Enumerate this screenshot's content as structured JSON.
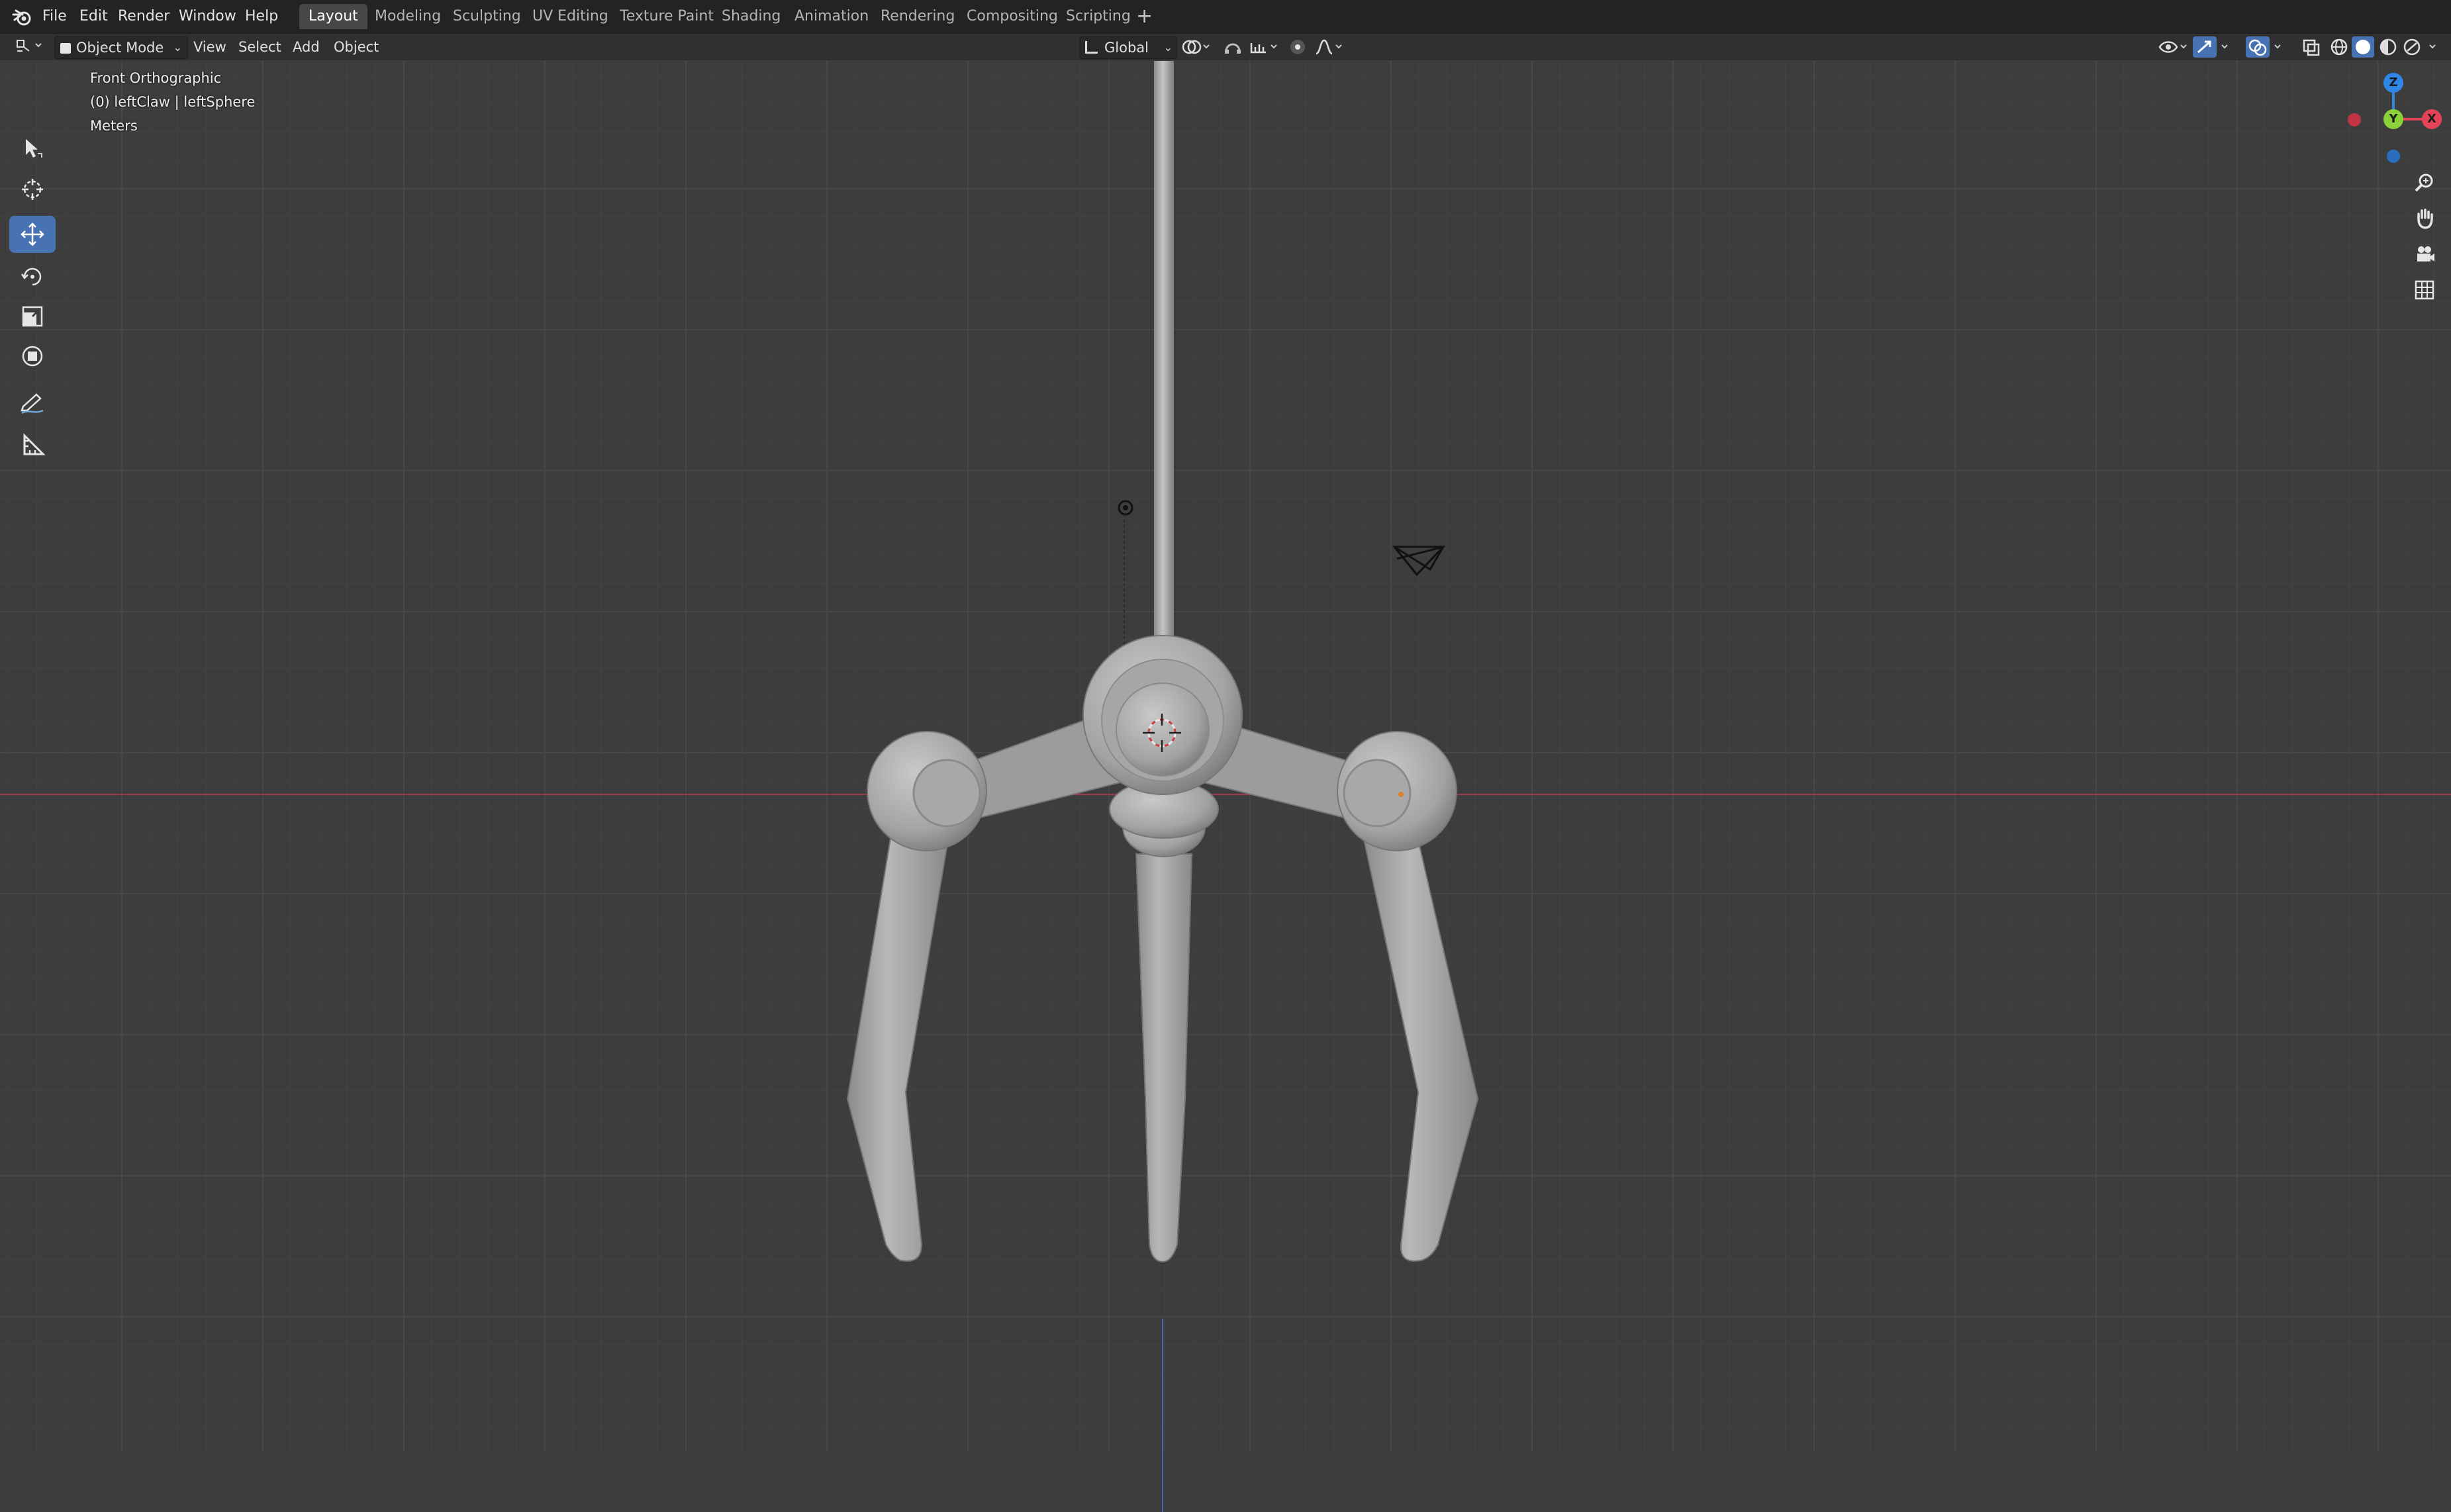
{
  "app": {
    "menus": [
      "File",
      "Edit",
      "Render",
      "Window",
      "Help"
    ],
    "workspace_tabs": [
      "Layout",
      "Modeling",
      "Sculpting",
      "UV Editing",
      "Texture Paint",
      "Shading",
      "Animation",
      "Rendering",
      "Compositing",
      "Scripting"
    ],
    "active_tab": "Layout",
    "add_tab_label": "+"
  },
  "header": {
    "mode": "Object Mode",
    "menus": [
      "View",
      "Select",
      "Add",
      "Object"
    ],
    "orientation": "Global"
  },
  "viewport": {
    "view_name": "Front Orthographic",
    "selection": "(0) leftClaw | leftSphere",
    "units": "Meters"
  },
  "gizmo": {
    "z_label": "Z",
    "y_label": "Y",
    "x_label": "X"
  },
  "toolbar": {
    "tools": [
      "select-box",
      "cursor",
      "move",
      "rotate",
      "scale",
      "transform",
      "annotate",
      "measure"
    ],
    "active_tool": "move"
  },
  "colors": {
    "x_axis": "#9a3c47",
    "z_axis": "#3f6ea8",
    "active_blue": "#4772b3",
    "gizmo_x": "#e44357",
    "gizmo_y": "#8bd13a",
    "gizmo_z": "#2e86e6"
  }
}
